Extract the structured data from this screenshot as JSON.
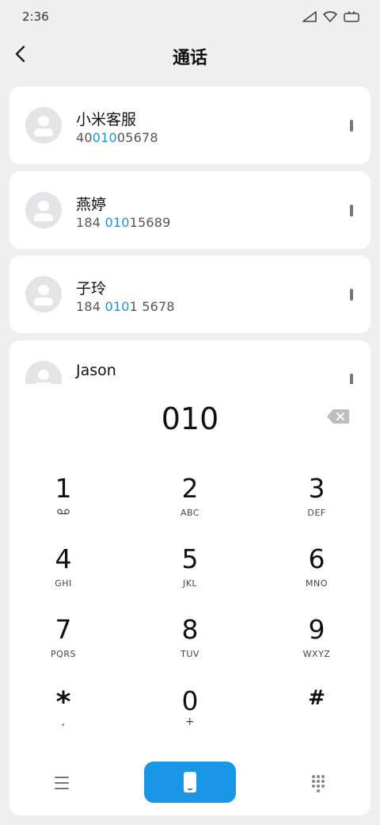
{
  "status": {
    "time": "2:36",
    "icons": [
      "signal-icon",
      "wifi-icon",
      "battery-icon"
    ]
  },
  "header": {
    "title": "通话",
    "back_icon": "chevron-left-icon"
  },
  "contacts": [
    {
      "name": "小米客服",
      "num_pre": "40",
      "num_hl": "010",
      "num_post": "05678"
    },
    {
      "name": "燕婷",
      "num_pre": "184 ",
      "num_hl": "010",
      "num_post": "15689"
    },
    {
      "name": "子玲",
      "num_pre": "184 ",
      "num_hl": "010",
      "num_post": "1 5678"
    },
    {
      "name": "Jason",
      "num_pre": "",
      "num_hl": "",
      "num_post": ""
    }
  ],
  "dialer": {
    "input": "010",
    "keys": [
      {
        "digit": "1",
        "letters": ""
      },
      {
        "digit": "2",
        "letters": "ABC"
      },
      {
        "digit": "3",
        "letters": "DEF"
      },
      {
        "digit": "4",
        "letters": "GHI"
      },
      {
        "digit": "5",
        "letters": "JKL"
      },
      {
        "digit": "6",
        "letters": "MNO"
      },
      {
        "digit": "7",
        "letters": "PQRS"
      },
      {
        "digit": "8",
        "letters": "TUV"
      },
      {
        "digit": "9",
        "letters": "WXYZ"
      },
      {
        "digit": "*",
        "letters": ","
      },
      {
        "digit": "0",
        "letters": "+"
      },
      {
        "digit": "#",
        "letters": ""
      }
    ],
    "voicemail_icon": "voicemail-icon"
  },
  "colors": {
    "accent": "#1a96e6",
    "background": "#efefef",
    "card": "#ffffff"
  }
}
